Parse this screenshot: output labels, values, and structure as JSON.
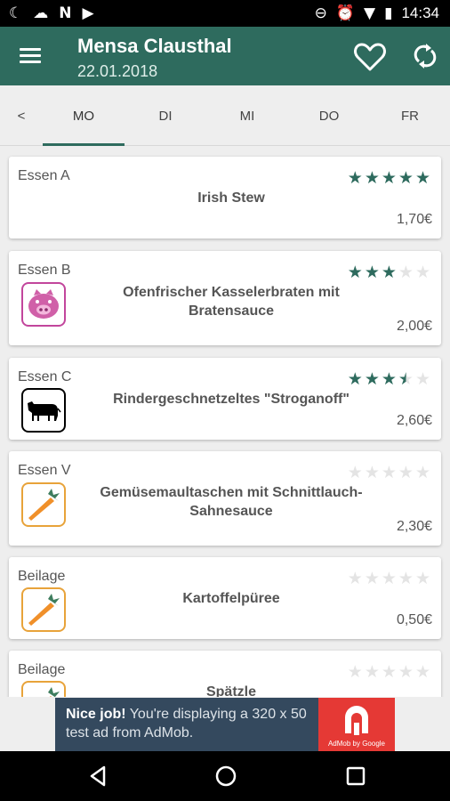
{
  "status_bar": {
    "left_icons": [
      "moon-icon",
      "cloud-icon",
      "n-icon",
      "play-check-icon"
    ],
    "right_icons": [
      "minus-circle-icon",
      "alarm-icon",
      "wifi-icon",
      "battery-icon"
    ],
    "time": "14:34"
  },
  "app_bar": {
    "title": "Mensa Clausthal",
    "date": "22.01.2018",
    "color": "#2e6b5e"
  },
  "tabs": {
    "prev": "<",
    "days": [
      "MO",
      "DI",
      "MI",
      "DO",
      "FR"
    ],
    "active": "MO"
  },
  "meals": [
    {
      "category": "Essen A",
      "name": "Irish Stew",
      "price": "1,70€",
      "rating": 5,
      "icon": null
    },
    {
      "category": "Essen B",
      "name": "Ofenfrischer Kasselerbraten mit Bratensauce",
      "price": "2,00€",
      "rating": 3,
      "icon": "pig-icon"
    },
    {
      "category": "Essen C",
      "name": "Rindergeschnetzeltes \"Stroganoff\"",
      "price": "2,60€",
      "rating": 3.5,
      "icon": "cow-icon"
    },
    {
      "category": "Essen V",
      "name": "Gemüsemaultaschen mit Schnittlauch-Sahnesauce",
      "price": "2,30€",
      "rating": 0,
      "icon": "carrot-icon"
    },
    {
      "category": "Beilage",
      "name": "Kartoffelpüree",
      "price": "0,50€",
      "rating": 0,
      "icon": "carrot-icon"
    },
    {
      "category": "Beilage",
      "name": "Spätzle",
      "price": "",
      "rating": 0,
      "icon": "carrot-icon"
    }
  ],
  "ad": {
    "bold": "Nice job!",
    "text": " You're displaying a 320 x 50 test ad from AdMob.",
    "logo_caption": "AdMob by Google"
  },
  "nav_bar": {
    "buttons": [
      "back-icon",
      "home-icon",
      "recents-icon"
    ]
  }
}
